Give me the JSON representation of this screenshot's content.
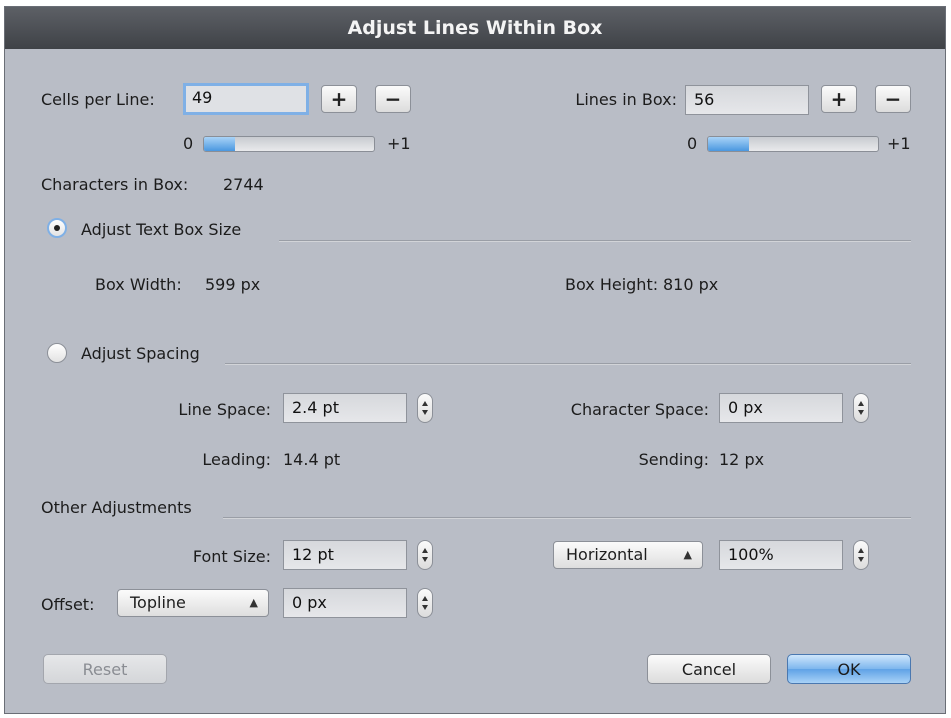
{
  "dialog": {
    "title": "Adjust Lines Within Box"
  },
  "cells_per_line": {
    "label": "Cells per Line:",
    "value": "49",
    "plus": "+",
    "minus": "−",
    "slider_min": "0",
    "slider_max": "+1",
    "slider_fraction": 0.18
  },
  "lines_in_box": {
    "label": "Lines in Box:",
    "value": "56",
    "plus": "+",
    "minus": "−",
    "slider_min": "0",
    "slider_max": "+1",
    "slider_fraction": 0.24
  },
  "characters_in_box": {
    "label": "Characters in Box:",
    "value": "2744"
  },
  "adjust_text_box_size": {
    "label": "Adjust Text Box Size",
    "selected": true,
    "box_width_label": "Box Width:",
    "box_width_value": "599 px",
    "box_height_label": "Box Height:",
    "box_height_value": "810 px"
  },
  "adjust_spacing": {
    "label": "Adjust Spacing",
    "selected": false,
    "line_space_label": "Line Space:",
    "line_space_value": "2.4 pt",
    "character_space_label": "Character Space:",
    "character_space_value": "0 px",
    "leading_label": "Leading:",
    "leading_value": "14.4 pt",
    "sending_label": "Sending:",
    "sending_value": "12 px"
  },
  "other_adjustments": {
    "label": "Other Adjustments",
    "font_size_label": "Font Size:",
    "font_size_value": "12 pt",
    "direction_selected": "Horizontal",
    "scale_value": "100%",
    "offset_label": "Offset:",
    "offset_selected": "Topline",
    "offset_value": "0 px"
  },
  "buttons": {
    "reset": "Reset",
    "cancel": "Cancel",
    "ok": "OK"
  },
  "colors": {
    "dialog_bg": "#b9bdc6",
    "titlebar": "#4a4d52",
    "accent": "#7fb0e6"
  }
}
